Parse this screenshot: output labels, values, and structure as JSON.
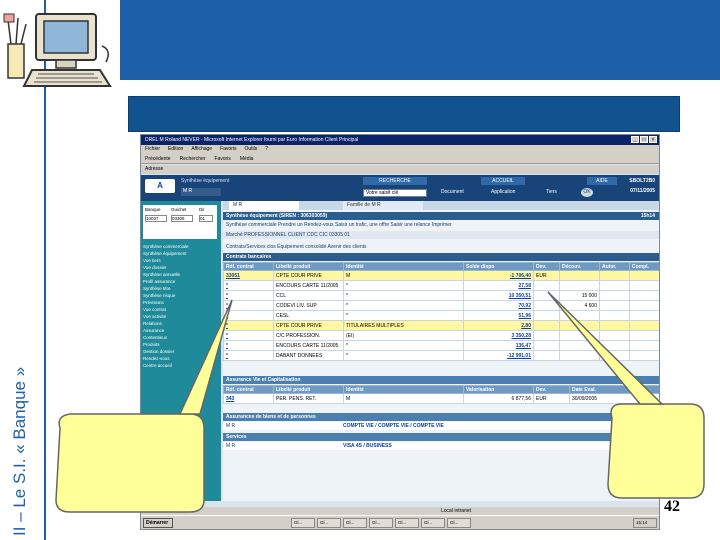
{
  "slide": {
    "vertical_title": "II – Le S.I. « Banque »",
    "page_number": "42"
  },
  "browser": {
    "window_title": "DREL M Roland NEVER - Microsoft Internet Explorer fourni par Euro Information Client Principal",
    "menu": [
      "Fichier",
      "Edition",
      "Affichage",
      "Favoris",
      "Outils",
      "?"
    ],
    "toolbar": [
      "Précédente",
      "Rechercher",
      "Favoris",
      "Média"
    ],
    "address_label": "Adresse",
    "status_text": "Local intranet"
  },
  "app": {
    "logo": "A",
    "header_left": "Synthèse équipement",
    "header_user": "M R",
    "tabs": [
      "RECHERCHE",
      "ACCUEIL",
      "AIDE"
    ],
    "search_value": "Votre saisit clé",
    "options": [
      "Document",
      "Application",
      "Tiers"
    ],
    "ok": "OK",
    "right_code": "SBOLT2B0",
    "right_date": "07/11/2005",
    "content_tabs": [
      "M R",
      "Famille de M R"
    ],
    "synth_title": "Synthèse équipement (SIREN : 306303059)",
    "synth_time": "15h14",
    "actions_line": "Synthèse commerciale   Prendre un Rendez-vous   Saisir un trafic, une offre   Saisir une relance   Imprimer",
    "client_line": "Marché PROFESSIONNEL   CLIENT   CDC   CIC   03305 01",
    "filters_line": "Contrats/Services clos   Équipement consolidé   Avenir des clients",
    "section_contrats": "Contrats bancaires",
    "section_assurance": "Assurance Vie et Capitalisation",
    "section_biens": "Assurances de biens et de personnes",
    "section_services": "Services",
    "biens_row": "COMPTE VIE / COMPTE VIE / COMPTE VIE",
    "services_row": "VISA 4S / BUSINESS"
  },
  "sidebar": {
    "fields": [
      "Banque",
      "Guichet",
      "Dir"
    ],
    "values": [
      "10037",
      "03305",
      "01"
    ],
    "entries": [
      "Synthèse commerciale",
      "Synthèse équipement",
      "Vue tiers",
      "Vue dossier",
      "Synthèse annuelle",
      "Profil assurance",
      "Synthèse titre",
      "Synthèse risque",
      "Prévisions",
      "Vue contrat",
      "Vue activité",
      "Relations",
      "Assurance",
      "Contentieux",
      "Produits",
      "Gestion dossier",
      "Rendez-vous",
      "Centre accueil"
    ]
  },
  "contracts_table": {
    "headers": [
      "Réf. contrat",
      "Libellé produit",
      "Identité",
      "Solde dispo",
      "Dev.",
      "Découv.",
      "Autor.",
      "Compl."
    ],
    "rows": [
      {
        "ref": "33051",
        "prod": "CPTE COUR PRIVE",
        "id": "M",
        "solde": "-1 706,40",
        "dev": "EUR",
        "dec": "",
        "aut": "",
        "highlight": true
      },
      {
        "ref": "*",
        "prod": "ENCOURS CARTE 11/2005",
        "id": "*",
        "solde": "27,58",
        "dev": "",
        "dec": "",
        "aut": "",
        "highlight": false
      },
      {
        "ref": "*",
        "prod": "CCL",
        "id": "*",
        "solde": "10 350,51",
        "dev": "",
        "dec": "15 000",
        "aut": "",
        "highlight": false
      },
      {
        "ref": "*",
        "prod": "CODEVI LIV. SUP",
        "id": "*",
        "solde": "70,92",
        "dev": "",
        "dec": "4 600",
        "aut": "",
        "highlight": false
      },
      {
        "ref": "*",
        "prod": "CESL",
        "id": "*",
        "solde": "51,96",
        "dev": "",
        "dec": "",
        "aut": "",
        "highlight": false
      },
      {
        "ref": "*",
        "prod": "CPTE COUR PRIVE",
        "id": "TITULAIRES MULTIPLES",
        "solde": "2,80",
        "dev": "",
        "dec": "",
        "aut": "",
        "highlight": true
      },
      {
        "ref": "*",
        "prod": "C/C PROFESSION.",
        "id": "(EI)",
        "solde": "3 350,28",
        "dev": "",
        "dec": "",
        "aut": "",
        "highlight": false
      },
      {
        "ref": "*",
        "prod": "ENCOURS CARTE 11/2005",
        "id": "*",
        "solde": "136,47",
        "dev": "",
        "dec": "",
        "aut": "",
        "highlight": false
      },
      {
        "ref": "*",
        "prod": "DABANT DONNEES",
        "id": "*",
        "solde": "-12 991,01",
        "dev": "",
        "dec": "",
        "aut": "",
        "highlight": false
      }
    ]
  },
  "assurance_table": {
    "headers": [
      "Réf. contrat",
      "Libellé produit",
      "Identité",
      "Valorisation",
      "Dev.",
      "Date Eval."
    ],
    "row": {
      "ref": "343",
      "prod": "PER. PENS. RET.",
      "id": "M",
      "val": "6 877,56",
      "dev": "EUR",
      "date": "30/09/2005"
    }
  },
  "taskbar": {
    "start": "Démarrer",
    "time": "15:14",
    "buttons": [
      "Gl...",
      "Gl...",
      "Gl...",
      "Gl...",
      "Gl...",
      "Gl...",
      "Gl..."
    ]
  },
  "colors": {
    "header_blue": "#1d5fa8",
    "title_box": "#12528f",
    "callout_fill": "#ffff99",
    "highlight_row": "#fff8a0"
  }
}
